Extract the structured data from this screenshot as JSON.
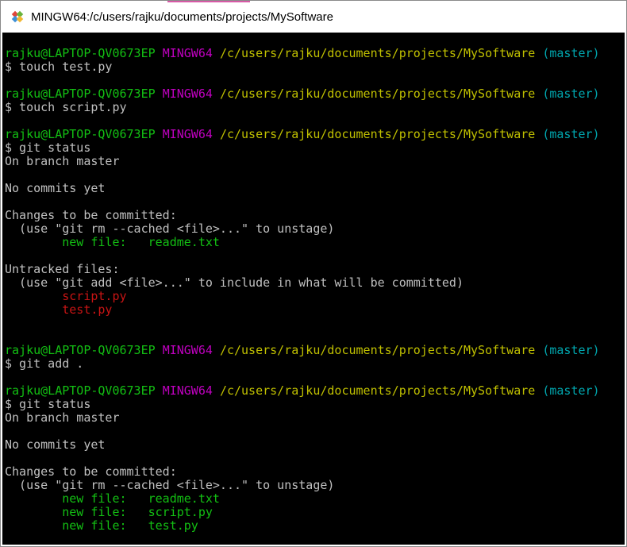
{
  "window": {
    "title": "MINGW64:/c/users/rajku/documents/projects/MySoftware",
    "icon": "git-bash-icon"
  },
  "colors": {
    "green": "#13c013",
    "magenta": "#c000c0",
    "yellow": "#c0c000",
    "cyan": "#00a8b0",
    "red": "#c81414",
    "text": "#c0c0c0"
  },
  "terminal": {
    "lines": [
      [],
      [
        [
          "g",
          "rajku@LAPTOP-QV0673EP "
        ],
        [
          "m",
          "MINGW64 "
        ],
        [
          "y",
          "/c/users/rajku/documents/projects/MySoftware "
        ],
        [
          "c",
          "(master)"
        ]
      ],
      [
        [
          "w",
          "$ touch test.py"
        ]
      ],
      [],
      [
        [
          "g",
          "rajku@LAPTOP-QV0673EP "
        ],
        [
          "m",
          "MINGW64 "
        ],
        [
          "y",
          "/c/users/rajku/documents/projects/MySoftware "
        ],
        [
          "c",
          "(master)"
        ]
      ],
      [
        [
          "w",
          "$ touch script.py"
        ]
      ],
      [],
      [
        [
          "g",
          "rajku@LAPTOP-QV0673EP "
        ],
        [
          "m",
          "MINGW64 "
        ],
        [
          "y",
          "/c/users/rajku/documents/projects/MySoftware "
        ],
        [
          "c",
          "(master)"
        ]
      ],
      [
        [
          "w",
          "$ git status"
        ]
      ],
      [
        [
          "w",
          "On branch master"
        ]
      ],
      [],
      [
        [
          "w",
          "No commits yet"
        ]
      ],
      [],
      [
        [
          "w",
          "Changes to be committed:"
        ]
      ],
      [
        [
          "w",
          "  (use \"git rm --cached <file>...\" to unstage)"
        ]
      ],
      [
        [
          "w",
          "        "
        ],
        [
          "g",
          "new file:   readme.txt"
        ]
      ],
      [],
      [
        [
          "w",
          "Untracked files:"
        ]
      ],
      [
        [
          "w",
          "  (use \"git add <file>...\" to include in what will be committed)"
        ]
      ],
      [
        [
          "w",
          "        "
        ],
        [
          "r",
          "script.py"
        ]
      ],
      [
        [
          "w",
          "        "
        ],
        [
          "r",
          "test.py"
        ]
      ],
      [],
      [],
      [
        [
          "g",
          "rajku@LAPTOP-QV0673EP "
        ],
        [
          "m",
          "MINGW64 "
        ],
        [
          "y",
          "/c/users/rajku/documents/projects/MySoftware "
        ],
        [
          "c",
          "(master)"
        ]
      ],
      [
        [
          "w",
          "$ git add ."
        ]
      ],
      [],
      [
        [
          "g",
          "rajku@LAPTOP-QV0673EP "
        ],
        [
          "m",
          "MINGW64 "
        ],
        [
          "y",
          "/c/users/rajku/documents/projects/MySoftware "
        ],
        [
          "c",
          "(master)"
        ]
      ],
      [
        [
          "w",
          "$ git status"
        ]
      ],
      [
        [
          "w",
          "On branch master"
        ]
      ],
      [],
      [
        [
          "w",
          "No commits yet"
        ]
      ],
      [],
      [
        [
          "w",
          "Changes to be committed:"
        ]
      ],
      [
        [
          "w",
          "  (use \"git rm --cached <file>...\" to unstage)"
        ]
      ],
      [
        [
          "w",
          "        "
        ],
        [
          "g",
          "new file:   readme.txt"
        ]
      ],
      [
        [
          "w",
          "        "
        ],
        [
          "g",
          "new file:   script.py"
        ]
      ],
      [
        [
          "w",
          "        "
        ],
        [
          "g",
          "new file:   test.py"
        ]
      ]
    ]
  }
}
